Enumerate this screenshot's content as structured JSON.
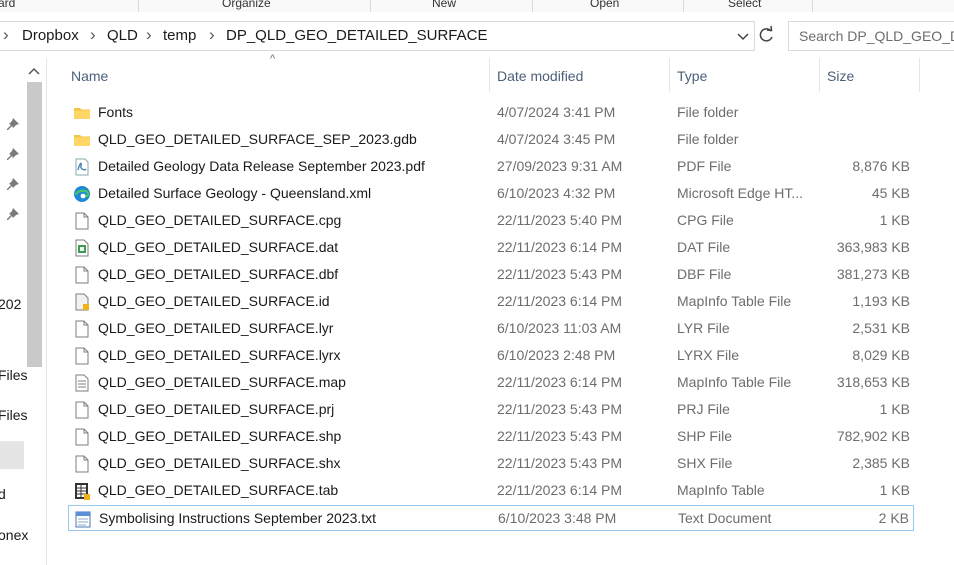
{
  "ribbon": {
    "groups": [
      "ard",
      "Organize",
      "New",
      "Open",
      "Select"
    ]
  },
  "breadcrumb": [
    "Dropbox",
    "QLD",
    "temp",
    "DP_QLD_GEO_DETAILED_SURFACE"
  ],
  "search": {
    "placeholder": "Search DP_QLD_GEO_DE"
  },
  "nav": {
    "items": [
      "202",
      "Files",
      "Files",
      "d",
      "onex"
    ]
  },
  "columns": {
    "name": "Name",
    "date": "Date modified",
    "type": "Type",
    "size": "Size"
  },
  "files": [
    {
      "name": "Fonts",
      "date": "4/07/2024 3:41 PM",
      "type": "File folder",
      "size": "",
      "icon": "folder-icon"
    },
    {
      "name": "QLD_GEO_DETAILED_SURFACE_SEP_2023.gdb",
      "date": "4/07/2024 3:45 PM",
      "type": "File folder",
      "size": "",
      "icon": "folder-icon"
    },
    {
      "name": "Detailed Geology Data Release September 2023.pdf",
      "date": "27/09/2023 9:31 AM",
      "type": "PDF File",
      "size": "8,876 KB",
      "icon": "pdf-icon"
    },
    {
      "name": "Detailed Surface Geology - Queensland.xml",
      "date": "6/10/2023 4:32 PM",
      "type": "Microsoft Edge HT...",
      "size": "45 KB",
      "icon": "edge-icon"
    },
    {
      "name": "QLD_GEO_DETAILED_SURFACE.cpg",
      "date": "22/11/2023 5:40 PM",
      "type": "CPG File",
      "size": "1 KB",
      "icon": "file-icon"
    },
    {
      "name": "QLD_GEO_DETAILED_SURFACE.dat",
      "date": "22/11/2023 6:14 PM",
      "type": "DAT File",
      "size": "363,983 KB",
      "icon": "dat-icon"
    },
    {
      "name": "QLD_GEO_DETAILED_SURFACE.dbf",
      "date": "22/11/2023 5:43 PM",
      "type": "DBF File",
      "size": "381,273 KB",
      "icon": "file-icon"
    },
    {
      "name": "QLD_GEO_DETAILED_SURFACE.id",
      "date": "22/11/2023 6:14 PM",
      "type": "MapInfo Table File",
      "size": "1,193 KB",
      "icon": "mapinfo-file-icon"
    },
    {
      "name": "QLD_GEO_DETAILED_SURFACE.lyr",
      "date": "6/10/2023 11:03 AM",
      "type": "LYR File",
      "size": "2,531 KB",
      "icon": "file-icon"
    },
    {
      "name": "QLD_GEO_DETAILED_SURFACE.lyrx",
      "date": "6/10/2023 2:48 PM",
      "type": "LYRX File",
      "size": "8,029 KB",
      "icon": "file-icon"
    },
    {
      "name": "QLD_GEO_DETAILED_SURFACE.map",
      "date": "22/11/2023 6:14 PM",
      "type": "MapInfo Table File",
      "size": "318,653 KB",
      "icon": "text-file-icon"
    },
    {
      "name": "QLD_GEO_DETAILED_SURFACE.prj",
      "date": "22/11/2023 5:43 PM",
      "type": "PRJ File",
      "size": "1 KB",
      "icon": "file-icon"
    },
    {
      "name": "QLD_GEO_DETAILED_SURFACE.shp",
      "date": "22/11/2023 5:43 PM",
      "type": "SHP File",
      "size": "782,902 KB",
      "icon": "file-icon"
    },
    {
      "name": "QLD_GEO_DETAILED_SURFACE.shx",
      "date": "22/11/2023 5:43 PM",
      "type": "SHX File",
      "size": "2,385 KB",
      "icon": "file-icon"
    },
    {
      "name": "QLD_GEO_DETAILED_SURFACE.tab",
      "date": "22/11/2023 6:14 PM",
      "type": "MapInfo Table",
      "size": "1 KB",
      "icon": "mapinfo-table-icon"
    },
    {
      "name": "Symbolising Instructions September 2023.txt",
      "date": "6/10/2023 3:48 PM",
      "type": "Text Document",
      "size": "2 KB",
      "icon": "notepad-icon"
    }
  ],
  "selected_index": 15,
  "colors": {
    "accent": "#99c9ef",
    "folder": "#f4c443",
    "header_text": "#4c607a"
  }
}
